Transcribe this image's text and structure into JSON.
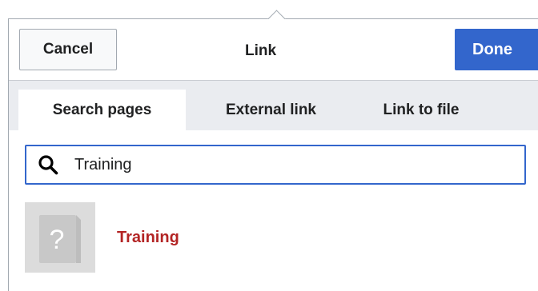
{
  "dialog": {
    "title": "Link",
    "cancel_label": "Cancel",
    "done_label": "Done"
  },
  "tabs": [
    {
      "label": "Search pages",
      "active": true
    },
    {
      "label": "External link",
      "active": false
    },
    {
      "label": "Link to file",
      "active": false
    }
  ],
  "search": {
    "value": "Training",
    "icon": "search-icon"
  },
  "results": [
    {
      "label": "Training",
      "thumbnail": "placeholder-question-icon"
    }
  ],
  "colors": {
    "accent": "#3366cc",
    "result_link": "#b32424",
    "tabbar_bg": "#eaecf0"
  }
}
